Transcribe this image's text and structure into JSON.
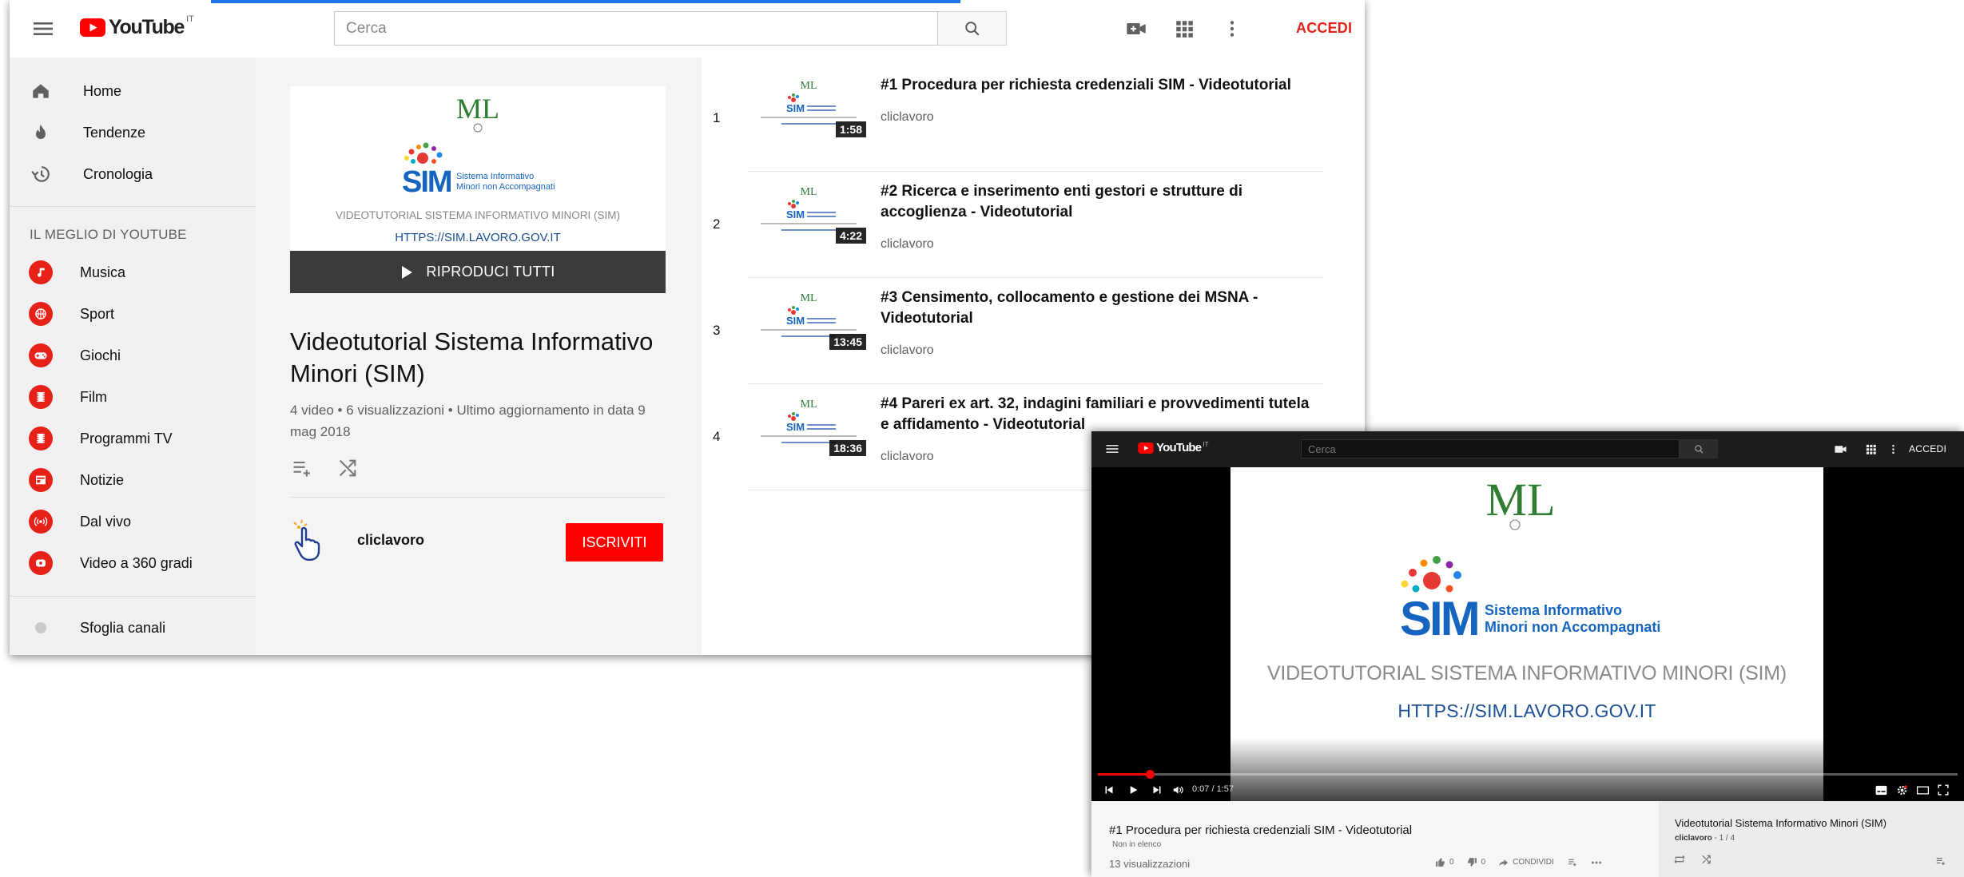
{
  "brand": {
    "logo_text": "YouTube",
    "country_code": "IT",
    "red": "#ff0000",
    "accent": "#e62117"
  },
  "header": {
    "search_placeholder": "Cerca",
    "signin_label": "ACCEDI"
  },
  "sidebar": {
    "main_items": [
      {
        "label": "Home",
        "icon": "home-icon"
      },
      {
        "label": "Tendenze",
        "icon": "flame-icon"
      },
      {
        "label": "Cronologia",
        "icon": "history-icon"
      }
    ],
    "best_heading": "IL MEGLIO DI YOUTUBE",
    "best_items": [
      {
        "label": "Musica",
        "icon": "music-icon"
      },
      {
        "label": "Sport",
        "icon": "sport-icon"
      },
      {
        "label": "Giochi",
        "icon": "gamepad-icon"
      },
      {
        "label": "Film",
        "icon": "film-icon"
      },
      {
        "label": "Programmi TV",
        "icon": "tv-icon"
      },
      {
        "label": "Notizie",
        "icon": "news-icon"
      },
      {
        "label": "Dal vivo",
        "icon": "live-icon"
      },
      {
        "label": "Video a 360 gradi",
        "icon": "vr360-icon"
      }
    ],
    "browse_label": "Sfoglia canali"
  },
  "playlist": {
    "thumb_caption": "VIDEOTUTORIAL SISTEMA INFORMATIVO MINORI (SIM)",
    "thumb_url": "HTTPS://SIM.LAVORO.GOV.IT",
    "play_all_label": "RIPRODUCI TUTTI",
    "title": "Videotutorial Sistema Informativo Minori (SIM)",
    "meta": "4 video • 6 visualizzazioni • Ultimo aggiornamento in data 9 mag 2018",
    "owner": "cliclavoro",
    "subscribe_label": "ISCRIVITI"
  },
  "sim_logo": {
    "monogram": "ML",
    "sim_text": "SIM",
    "line1": "Sistema Informativo",
    "line2": "Minori non Accompagnati"
  },
  "videos": [
    {
      "index": "1",
      "title": "#1 Procedura per richiesta credenziali SIM - Videotutorial",
      "channel": "cliclavoro",
      "duration": "1:58"
    },
    {
      "index": "2",
      "title": "#2 Ricerca e inserimento enti gestori e strutture di accoglienza - Videotutorial",
      "channel": "cliclavoro",
      "duration": "4:22"
    },
    {
      "index": "3",
      "title": "#3 Censimento, collocamento e gestione dei MSNA - Videotutorial",
      "channel": "cliclavoro",
      "duration": "13:45"
    },
    {
      "index": "4",
      "title": "#4 Pareri ex art. 32, indagini familiari e provvedimenti tutela e affidamento - Videotutorial",
      "channel": "cliclavoro",
      "duration": "18:36"
    }
  ],
  "watch": {
    "search_placeholder": "Cerca",
    "signin_label": "ACCEDI",
    "frame_title": "VIDEOTUTORIAL SISTEMA INFORMATIVO MINORI (SIM)",
    "frame_url": "HTTPS://SIM.LAVORO.GOV.IT",
    "time_text": "0:07 / 1:57",
    "progress": 0.06,
    "video_title": "#1 Procedura per richiesta credenziali SIM - Videotutorial",
    "unlisted_label": "Non in elenco",
    "views": "13 visualizzazioni",
    "likes": "0",
    "dislikes": "0",
    "share_label": "CONDIVIDI",
    "queue_title": "Videotutorial Sistema Informativo Minori (SIM)",
    "queue_owner": "cliclavoro",
    "queue_position": "- 1 / 4"
  }
}
